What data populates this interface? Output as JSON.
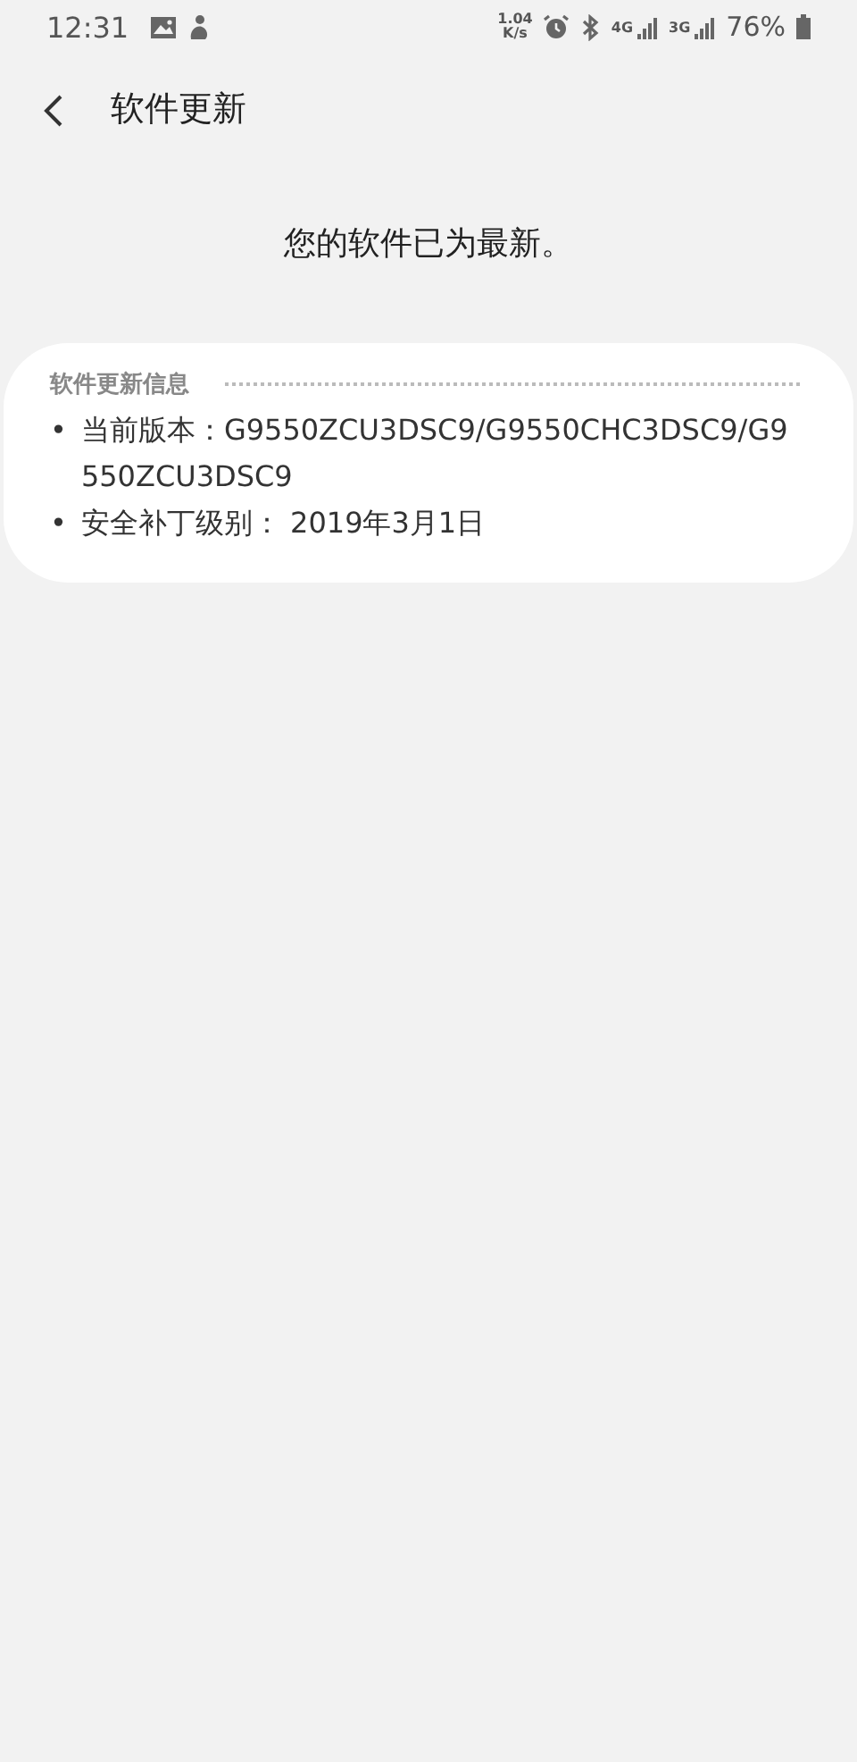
{
  "status_bar": {
    "time": "12:31",
    "net_speed": {
      "value": "1.04",
      "unit": "K/s"
    },
    "network_1": "4G",
    "network_2": "3G",
    "battery": "76%"
  },
  "header": {
    "title": "软件更新"
  },
  "message": "您的软件已为最新。",
  "info_card": {
    "title": "软件更新信息",
    "items": [
      {
        "bullet": "•",
        "text": "当前版本：G9550ZCU3DSC9/G9550CHC3DSC9/G9550ZCU3DSC9"
      },
      {
        "bullet": "•",
        "text": "安全补丁级别： 2019年3月1日"
      }
    ]
  }
}
